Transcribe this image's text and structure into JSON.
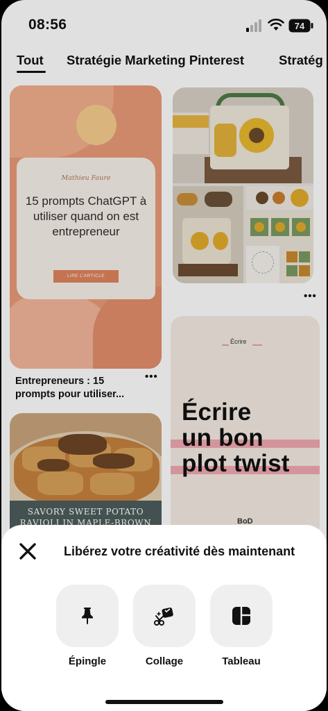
{
  "status": {
    "time": "08:56",
    "battery": "74"
  },
  "tabs": [
    {
      "label": "Tout"
    },
    {
      "label": "Stratégie Marketing Pinterest"
    },
    {
      "label": "Stratég"
    }
  ],
  "pins": {
    "prompts": {
      "brand": "Mathieu Faure",
      "title": "15 prompts ChatGPT à utiliser quand on est entrepreneur",
      "button": "LIRE L'ARTICLE",
      "caption": "Entrepreneurs : 15 prompts pour utiliser..."
    },
    "pasta": {
      "title": "SAVORY SWEET POTATO RAVIOLI IN MAPLE-BROWN"
    },
    "ecrire": {
      "label": "Écrire",
      "lines": [
        "Écrire",
        "un bon",
        "plot twist"
      ],
      "author": "BoD"
    },
    "more_icon": "more-horizontal-icon"
  },
  "sheet": {
    "title": "Libérez votre créativité dès maintenant",
    "actions": [
      {
        "label": "Épingle",
        "icon": "pin-icon"
      },
      {
        "label": "Collage",
        "icon": "collage-scissors-icon"
      },
      {
        "label": "Tableau",
        "icon": "board-icon"
      }
    ]
  },
  "colors": {
    "accent": "#e0855d",
    "highlight": "#f2a9b2",
    "sheet_button": "#efefef"
  }
}
